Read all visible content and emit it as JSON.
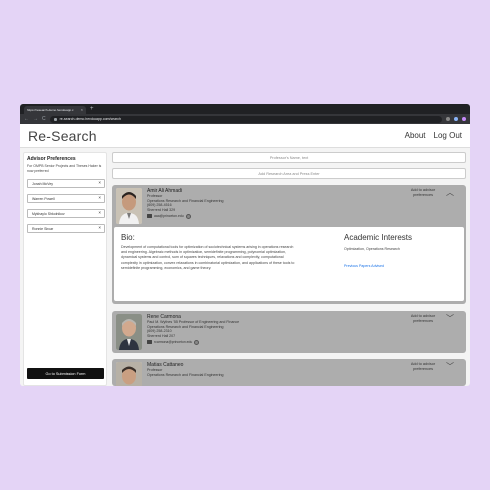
{
  "browser": {
    "tab_title": "https://research-demo.herokuapp.c",
    "tab_close": "×",
    "new_tab": "+",
    "url": "re-search-demo.herokuapp.com/search",
    "back": "←",
    "forward": "→",
    "reload": "C"
  },
  "header": {
    "logo": "Re-Search",
    "about": "About",
    "logout": "Log Out"
  },
  "sidebar": {
    "title": "Advisor Preferences",
    "note": "For OMPB Senior Projects and Theses Haker is now preferred",
    "preferences": [
      {
        "name": "Jonah McVey",
        "remove": "×"
      },
      {
        "name": "Warren Powell",
        "remove": "×"
      },
      {
        "name": "Mykhaylo Shkolnikov",
        "remove": "×"
      },
      {
        "name": "Ronnie Sircar",
        "remove": "×"
      }
    ],
    "submit_label": "Go to Submission Form"
  },
  "main": {
    "search_placeholder": "Professor's Name, text",
    "filter_placeholder": "Add Research Area and Press Enter",
    "cards": [
      {
        "name": "Amir Ali Ahmadi",
        "title": "Professor",
        "department": "Operations Research and Financial Engineering",
        "phone": "(609) 258-4516",
        "office": "Sherrerd Hall 329",
        "email": "aaa@princeton.edu",
        "add_pref": "Add to advisor preferences",
        "chevron": "︿",
        "expanded": true
      },
      {
        "name": "Rene Carmona",
        "title": "Paul M. Wythes '55 Professor of Engineering and Finance",
        "department": "Operations Research and Financial Engineering",
        "phone": "(609) 258-2310",
        "office": "Sherrerd Hall 207",
        "email": "rcarmona@princeton.edu",
        "add_pref": "Add to advisor preferences",
        "chevron": "﹀",
        "expanded": false
      },
      {
        "name": "Matias Cattaneo",
        "title": "Professor",
        "department": "Operations Research and Financial Engineering",
        "add_pref": "Add to advisor preferences",
        "chevron": "﹀",
        "expanded": false
      }
    ],
    "bio": {
      "heading": "Bio:",
      "text": "Development of computational tools for optimization of sociotechnical systems arising in operations research and engineering. Algebraic methods in optimization, semidefinite programming, polynomial optimization, dynamical systems and control, sum of squares techniques, relaxations and complexity, computational complexity in optimization, convex relaxations in combinatorial optimization, and applications of these tools to semidefinite programming, economics, and game theory.",
      "interests_heading": "Academic Interests",
      "interests": "Optimization, Operations Research",
      "link": "Previous Papers Advised"
    }
  },
  "colors": {
    "background": "#e4d4f6",
    "card": "#adadad",
    "button": "#111111",
    "link": "#1a73e8"
  }
}
